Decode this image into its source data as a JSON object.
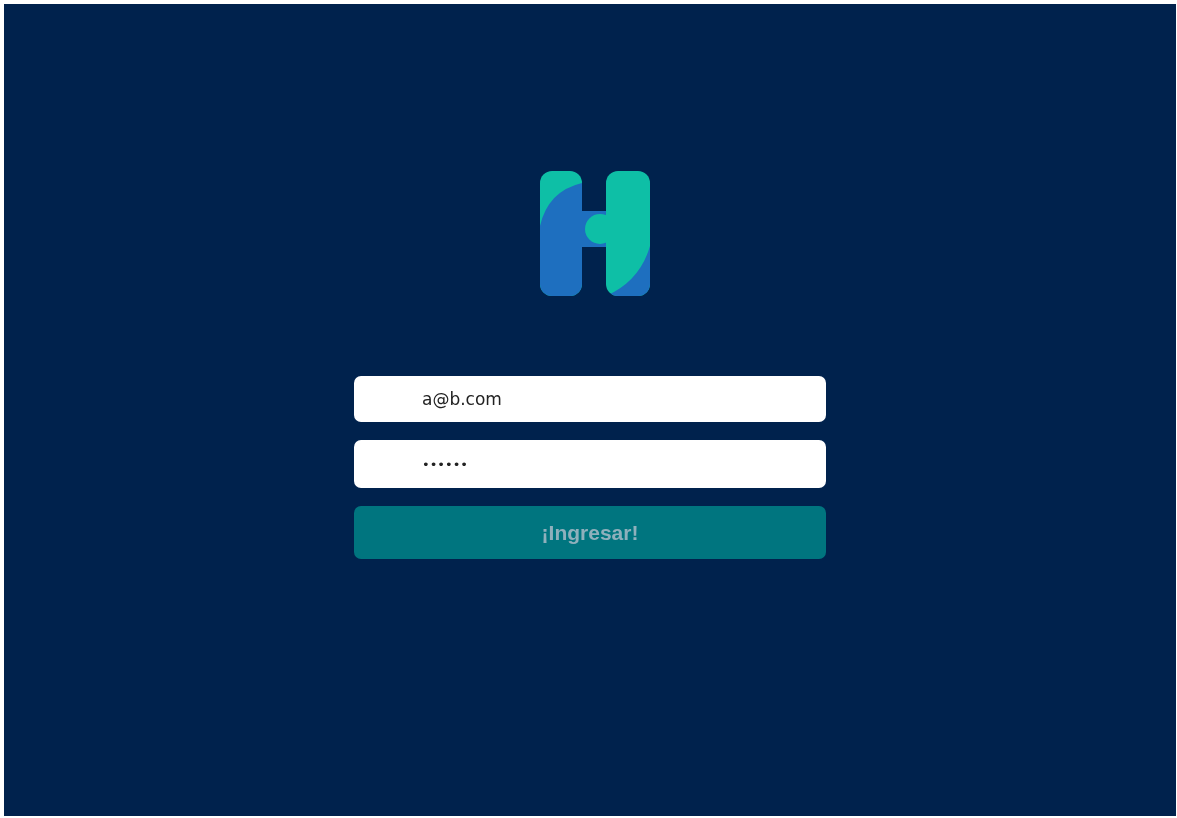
{
  "login_form": {
    "email": {
      "value": "a@b.com"
    },
    "password": {
      "value": "••••••"
    },
    "submit_button": {
      "label": "¡Ingresar!",
      "disabled": true
    }
  }
}
